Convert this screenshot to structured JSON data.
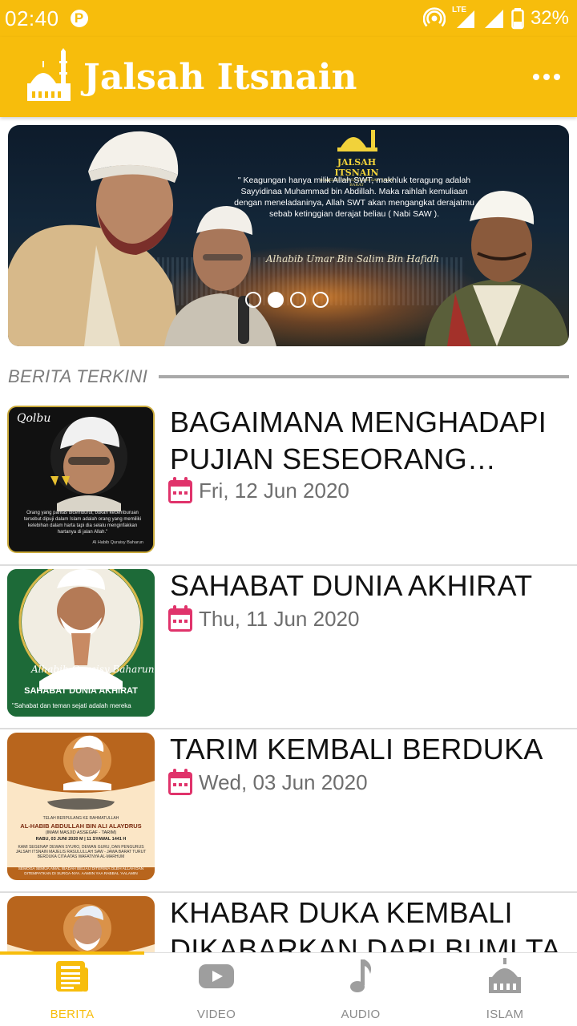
{
  "status_bar": {
    "time": "02:40",
    "notification_badge": "P",
    "network_type": "LTE",
    "battery": "32%"
  },
  "app_bar": {
    "title": "Jalsah Itsnain",
    "logo_icon": "mosque-logo-icon",
    "menu_icon": "more-horizontal-icon"
  },
  "banner": {
    "brand_name": "JALSAH ITSNAIN",
    "brand_sub": "MAJELIS RASULULLAH SAW JAWA BARAT",
    "quote": "\" Keagungan hanya milik Allah SWT, makhluk teragung adalah Sayyidinaa Muhammad bin Abdillah. Maka raihlah kemuliaan dengan meneladaninya, Allah SWT akan mengangkat derajatmu sebab ketinggian derajat beliau ( Nabi SAW ).",
    "signature": "Alhabib Umar Bin Salim Bin Hafidh",
    "slides_total": 4,
    "slide_active": 1
  },
  "section": {
    "label": "BERITA TERKINI"
  },
  "news": [
    {
      "title": "BAGAIMANA MENGHADAPI PUJIAN SESEORANG TERHA...",
      "date": "Fri, 12 Jun 2020"
    },
    {
      "title": "SAHABAT DUNIA AKHIRAT",
      "date": "Thu, 11 Jun 2020"
    },
    {
      "title": "TARIM KEMBALI BERDUKA",
      "date": "Wed, 03 Jun 2020"
    },
    {
      "title": "KHABAR DUKA KEMBALI DIKABARKAN DARI BUMI TA",
      "date": ""
    }
  ],
  "thumbs": {
    "t1_brand": "Qolbu",
    "t1_quote": "Orang yang pantas dicemburui, bukan kecemburuan tersebut dipuji dalam Islam adalah orang yang memiliki kelebihan dalam harta tapi dia selalu menginfakkan hartanya di jalan Allah.\"",
    "t1_author": "Al Habib Quraisy Baharun",
    "t2_sig": "Alhabib Quraisy Baharun",
    "t2_caption": "SAHABAT DUNIA AKHIRAT",
    "t2_quote": "\"Sahabat dan teman sejati adalah mereka",
    "t3_line1": "TELAH BERPULANG KE RAHMATULLAH",
    "t3_name": "AL-HABIB ABDULLAH BIN ALI ALAYDRUS",
    "t3_role": "(IMAM MASJID ASSEGAF - TARIM)",
    "t3_date": "RABU, 03 JUNI 2020 M | 11 SYAWAL 1441 H",
    "t3_body": "KAMI SEGENAP DEWAN SYURO, DEWAN GURU, DAN PENGURUS JALSAH ITSNAIN MAJELIS RASULULLAH SAW - JAWA BARAT TURUT BERDUKA CITA ATAS WAFATNYA AL-MARHUM",
    "t3_prayer": "SEMOGA SEMUA AMAL IBADAH BELIAU DITERIMA OLEH ALLAH DAN DITEMPATKAN DI SURGA-NYA. AAMIIN YAA RABBAL 'AALAMIN"
  },
  "bottom_nav": [
    {
      "label": "BERITA",
      "icon": "newspaper-icon",
      "active": true
    },
    {
      "label": "VIDEO",
      "icon": "youtube-play-icon",
      "active": false
    },
    {
      "label": "AUDIO",
      "icon": "music-note-icon",
      "active": false
    },
    {
      "label": "ISLAM",
      "icon": "mosque-icon",
      "active": false
    }
  ],
  "colors": {
    "primary": "#f7bd0c",
    "date_icon": "#e0336b",
    "text_dark": "#111111",
    "text_muted": "#6e6e6e"
  }
}
